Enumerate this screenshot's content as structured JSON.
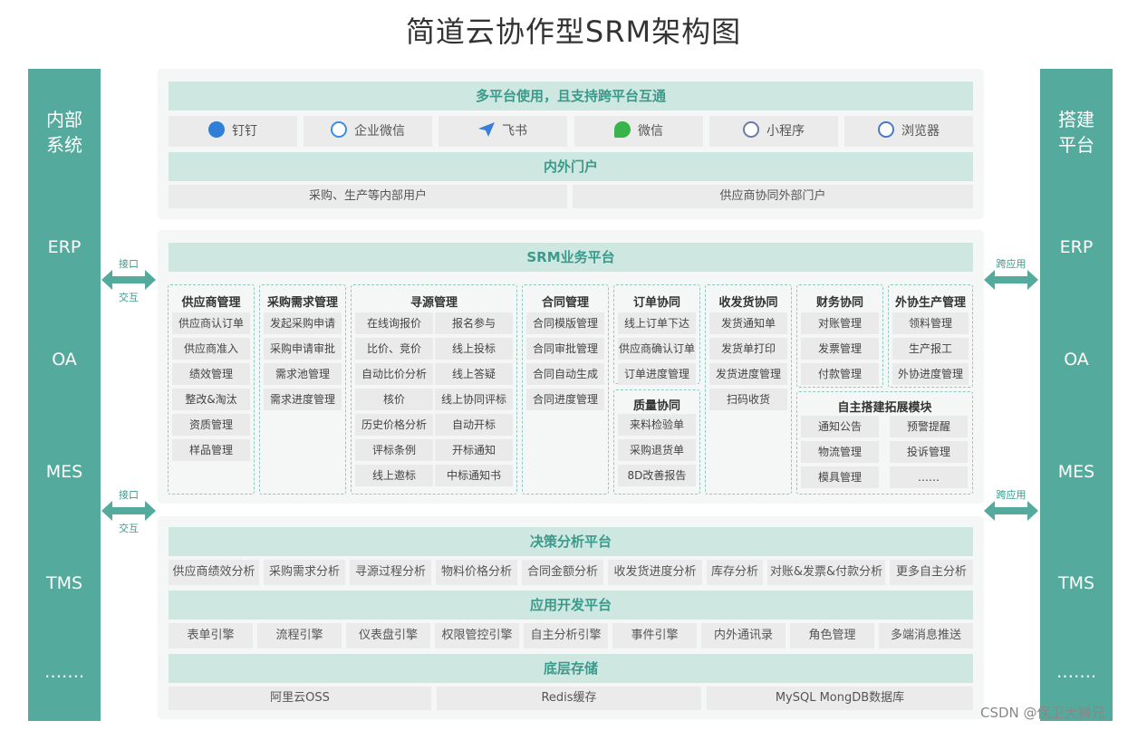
{
  "title": "简道云协作型SRM架构图",
  "left_sidebar": {
    "title_line1": "内部",
    "title_line2": "系统",
    "items": [
      "ERP",
      "OA",
      "MES",
      "TMS",
      "……."
    ]
  },
  "right_sidebar": {
    "title_line1": "搭建",
    "title_line2": "平台",
    "items": [
      "ERP",
      "OA",
      "MES",
      "TMS",
      "……."
    ]
  },
  "left_arrows": [
    {
      "l1": "接口",
      "l2": "交互"
    },
    {
      "l1": "接口",
      "l2": "交互"
    }
  ],
  "right_arrows": [
    "跨应用",
    "跨应用"
  ],
  "top_panel": {
    "multi_platform_title": "多平台使用，且支持跨平台互通",
    "platforms": [
      {
        "label": "钉钉",
        "icon": "dingtalk-icon",
        "color": "#2f7fd8"
      },
      {
        "label": "企业微信",
        "icon": "wecom-icon",
        "color": "#3c8fe0"
      },
      {
        "label": "飞书",
        "icon": "feishu-icon",
        "color": "#3b7ed9"
      },
      {
        "label": "微信",
        "icon": "wechat-icon",
        "color": "#37b44a"
      },
      {
        "label": "小程序",
        "icon": "miniprogram-icon",
        "color": "#6b7ca8"
      },
      {
        "label": "浏览器",
        "icon": "browser-icon",
        "color": "#4a78c8"
      }
    ],
    "portal_title": "内外门户",
    "portals": [
      "采购、生产等内部用户",
      "供应商协同外部门户"
    ]
  },
  "srm": {
    "title": "SRM业务平台",
    "modules": {
      "supplier": {
        "title": "供应商管理",
        "items": [
          "供应商认订单",
          "供应商准入",
          "绩效管理",
          "整改&淘汰",
          "资质管理",
          "样品管理"
        ]
      },
      "demand": {
        "title": "采购需求管理",
        "items": [
          "发起采购申请",
          "采购申请审批",
          "需求池管理",
          "需求进度管理"
        ]
      },
      "sourcing": {
        "title": "寻源管理",
        "items": [
          "在线询报价",
          "报名参与",
          "比价、竞价",
          "线上投标",
          "自动比价分析",
          "线上答疑",
          "核价",
          "线上协同评标",
          "历史价格分析",
          "自动开标",
          "评标条例",
          "开标通知",
          "线上邀标",
          "中标通知书"
        ]
      },
      "contract": {
        "title": "合同管理",
        "items": [
          "合同模版管理",
          "合同审批管理",
          "合同自动生成",
          "合同进度管理"
        ]
      },
      "order": {
        "title": "订单协同",
        "items": [
          "线上订单下达",
          "供应商确认订单",
          "订单进度管理"
        ]
      },
      "quality": {
        "title": "质量协同",
        "items": [
          "来料检验单",
          "采购退货单",
          "8D改善报告"
        ]
      },
      "delivery": {
        "title": "收发货协同",
        "items": [
          "发货通知单",
          "发货单打印",
          "发货进度管理",
          "扫码收货"
        ]
      },
      "finance": {
        "title": "财务协同",
        "items": [
          "对账管理",
          "发票管理",
          "付款管理"
        ]
      },
      "outsource": {
        "title": "外协生产管理",
        "items": [
          "领料管理",
          "生产报工",
          "外协进度管理"
        ]
      },
      "extend": {
        "title": "自主搭建拓展模块",
        "items": [
          "通知公告",
          "预警提醒",
          "物流管理",
          "投诉管理",
          "模具管理",
          "……"
        ]
      }
    }
  },
  "bottom_panel": {
    "decision_title": "决策分析平台",
    "decision_items": [
      "供应商绩效分析",
      "采购需求分析",
      "寻源过程分析",
      "物料价格分析",
      "合同金额分析",
      "收发货进度分析",
      "库存分析",
      "对账&发票&付款分析",
      "更多自主分析"
    ],
    "dev_title": "应用开发平台",
    "dev_items": [
      "表单引擎",
      "流程引擎",
      "仪表盘引擎",
      "权限管控引擎",
      "自主分析引擎",
      "事件引擎",
      "内外通讯录",
      "角色管理",
      "多端消息推送"
    ],
    "storage_title": "底层存储",
    "storage_items": [
      "阿里云OSS",
      "Redis缓存",
      "MySQL MongDB数据库"
    ]
  },
  "colors": {
    "primary": "#54aa9c",
    "bar_bg": "#cfe7e1",
    "bar_text": "#3a9a8b",
    "cell_bg": "#ebebeb"
  },
  "watermark": "CSDN @保卫大狮兄"
}
